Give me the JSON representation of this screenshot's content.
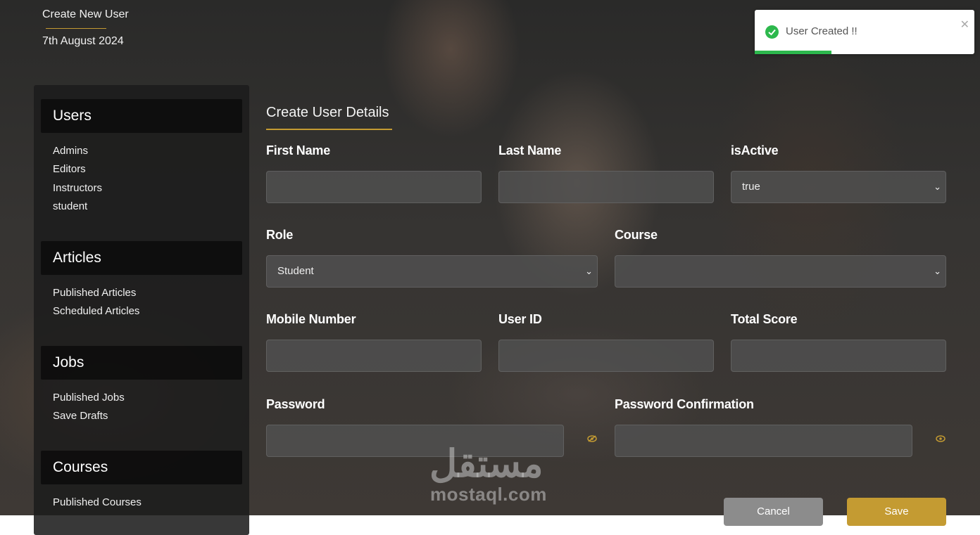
{
  "header": {
    "page_title": "Create New User",
    "date": "7th August 2024"
  },
  "sidebar": {
    "sections": [
      {
        "title": "Users",
        "items": [
          "Admins",
          "Editors",
          "Instructors",
          "student"
        ]
      },
      {
        "title": "Articles",
        "items": [
          "Published Articles",
          "Scheduled Articles"
        ]
      },
      {
        "title": "Jobs",
        "items": [
          "Published Jobs",
          "Save Drafts"
        ]
      },
      {
        "title": "Courses",
        "items": [
          "Published Courses"
        ]
      }
    ]
  },
  "form": {
    "title": "Create User Details",
    "labels": {
      "first_name": "First Name",
      "last_name": "Last Name",
      "is_active": "isActive",
      "role": "Role",
      "course": "Course",
      "mobile": "Mobile Number",
      "user_id": "User ID",
      "total_score": "Total Score",
      "password": "Password",
      "password_confirmation": "Password Confirmation"
    },
    "values": {
      "first_name": "",
      "last_name": "",
      "is_active": "true",
      "role": "Student",
      "course": "",
      "mobile": "",
      "user_id": "",
      "total_score": "",
      "password": "",
      "password_confirmation": ""
    },
    "buttons": {
      "cancel": "Cancel",
      "save": "Save"
    }
  },
  "watermark": {
    "arabic": "مستقل",
    "latin": "mostaql.com"
  },
  "toast": {
    "message": "User Created !!",
    "progress": 0.35,
    "status_color": "#2db84d"
  },
  "colors": {
    "accent": "#c49b32",
    "success": "#2db84d"
  }
}
